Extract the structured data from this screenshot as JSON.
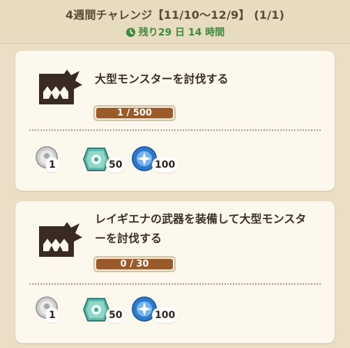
{
  "header": {
    "title": "4週間チャレンジ【11/10〜12/9】 (1/1)",
    "timer": "残り29 日 14 時間",
    "timer_icon": "clock-icon"
  },
  "missions": [
    {
      "icon": "monster-jaw-icon",
      "title": "大型モンスターを討伐する",
      "progress": "1 / 500",
      "progress_fraction": 0.002,
      "rewards": [
        {
          "icon": "silver-coin-icon",
          "count": "1"
        },
        {
          "icon": "green-gem-icon",
          "count": "50"
        },
        {
          "icon": "blue-crystal-icon",
          "count": "100"
        }
      ]
    },
    {
      "icon": "monster-jaw-icon",
      "title": "レイギエナの武器を装備して大型モンスターを討伐する",
      "progress": "0 / 30",
      "progress_fraction": 0,
      "rewards": [
        {
          "icon": "silver-coin-icon",
          "count": "1"
        },
        {
          "icon": "green-gem-icon",
          "count": "50"
        },
        {
          "icon": "blue-crystal-icon",
          "count": "100"
        }
      ]
    }
  ],
  "colors": {
    "background": "#eadfc6",
    "card": "#fdf8ee",
    "timer_green": "#3c8a3a",
    "progress_brown": "#9b5a2a"
  }
}
